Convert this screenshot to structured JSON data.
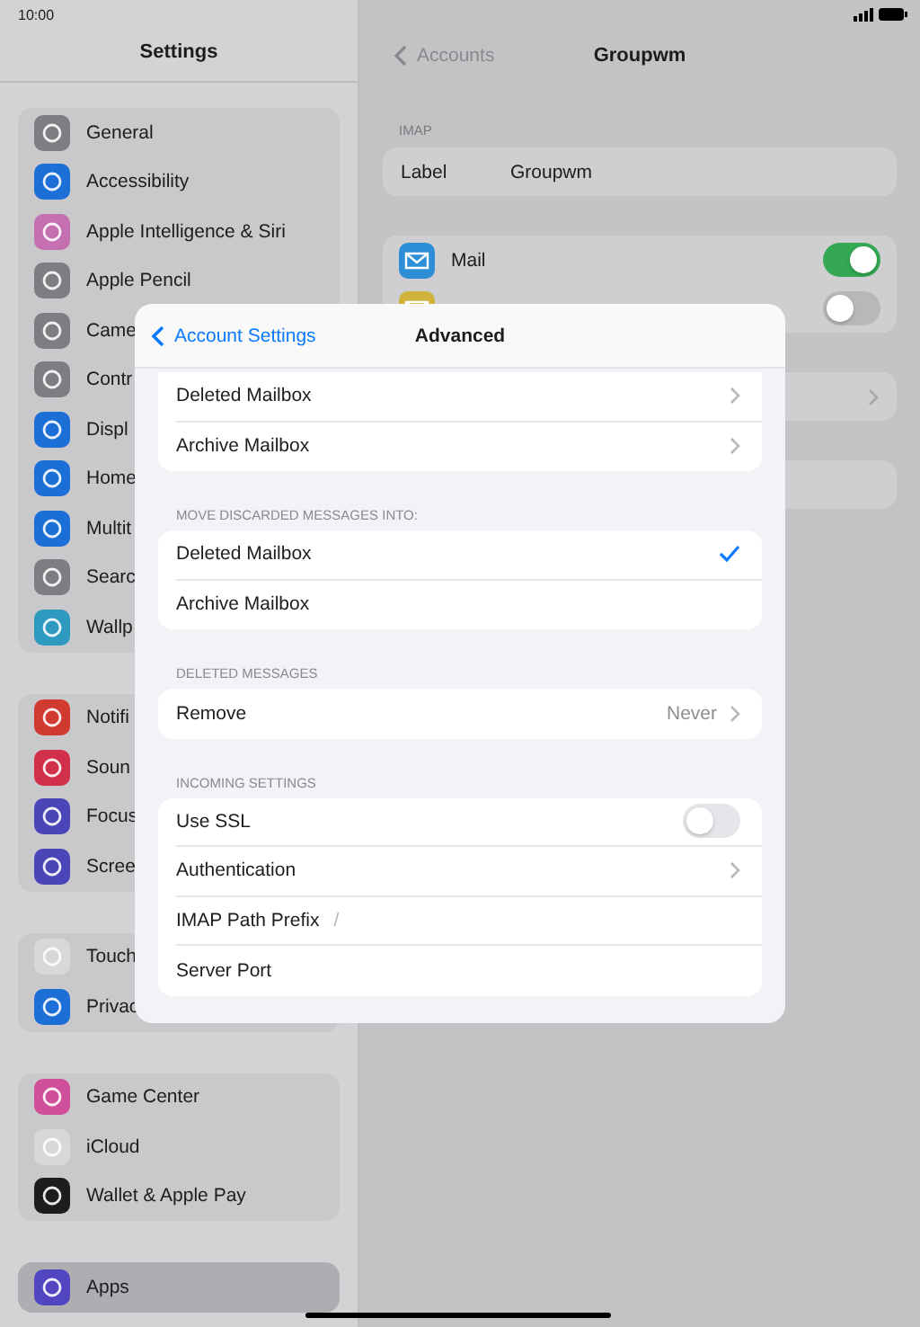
{
  "status_bar": {
    "time": "10:00"
  },
  "sidebar": {
    "title": "Settings",
    "groups": [
      [
        {
          "label": "General",
          "color": "#7d7d82",
          "selected": false
        },
        {
          "label": "Accessibility",
          "color": "#1c6fd6",
          "selected": false
        },
        {
          "label": "Apple Intelligence & Siri",
          "color": "#c46fb0",
          "selected": false
        },
        {
          "label": "Apple Pencil",
          "color": "#7d7d82",
          "selected": false
        },
        {
          "label": "Came",
          "color": "#7d7d82",
          "selected": false
        },
        {
          "label": "Contr",
          "color": "#7d7d82",
          "selected": false
        },
        {
          "label": "Displ",
          "color": "#1c6fd6",
          "selected": false
        },
        {
          "label": "Home",
          "color": "#1c6fd6",
          "selected": false
        },
        {
          "label": "Multit",
          "color": "#1c6fd6",
          "selected": false
        },
        {
          "label": "Searc",
          "color": "#7d7d82",
          "selected": false
        },
        {
          "label": "Wallp",
          "color": "#2f9ac0",
          "selected": false
        }
      ],
      [
        {
          "label": "Notifi",
          "color": "#d13a30",
          "selected": false
        },
        {
          "label": "Soun",
          "color": "#d1304b",
          "selected": false
        },
        {
          "label": "Focus",
          "color": "#4b46b8",
          "selected": false
        },
        {
          "label": "Scree",
          "color": "#4b46b8",
          "selected": false
        }
      ],
      [
        {
          "label": "Touch",
          "color": "#d8d8da",
          "selected": false
        },
        {
          "label": "Privac",
          "color": "#1c6fd6",
          "selected": false
        }
      ],
      [
        {
          "label": "Game Center",
          "color": "#d04f9a",
          "selected": false
        },
        {
          "label": "iCloud",
          "color": "#d8d8da",
          "selected": false
        },
        {
          "label": "Wallet & Apple Pay",
          "color": "#1d1d1f",
          "selected": false
        }
      ],
      [
        {
          "label": "Apps",
          "color": "#5146c0",
          "selected": true
        }
      ]
    ]
  },
  "detail": {
    "back": "Accounts",
    "title": "Groupwm",
    "section": "IMAP",
    "label_row": {
      "label": "Label",
      "value": "Groupwm"
    },
    "services": [
      {
        "label": "Mail",
        "color": "#2f8fd6",
        "on": true
      },
      {
        "color": "#d1b23a",
        "on": false
      }
    ]
  },
  "modal": {
    "back": "Account Settings",
    "title": "Advanced",
    "groups": [
      {
        "rows": [
          {
            "kind": "chevron",
            "label": "Deleted Mailbox"
          },
          {
            "kind": "chevron",
            "label": "Archive Mailbox"
          }
        ]
      },
      {
        "header": "MOVE DISCARDED MESSAGES INTO:",
        "rows": [
          {
            "kind": "check",
            "label": "Deleted Mailbox",
            "selected": true
          },
          {
            "kind": "check",
            "label": "Archive Mailbox",
            "selected": false
          }
        ]
      },
      {
        "header": "DELETED MESSAGES",
        "rows": [
          {
            "kind": "chevron",
            "label": "Remove",
            "value": "Never"
          }
        ]
      },
      {
        "header": "INCOMING SETTINGS",
        "rows": [
          {
            "kind": "toggle",
            "label": "Use SSL",
            "on": false
          },
          {
            "kind": "chevron",
            "label": "Authentication"
          },
          {
            "kind": "text",
            "label": "IMAP Path Prefix",
            "placeholder": "/"
          },
          {
            "kind": "text",
            "label": "Server Port"
          }
        ]
      }
    ]
  }
}
